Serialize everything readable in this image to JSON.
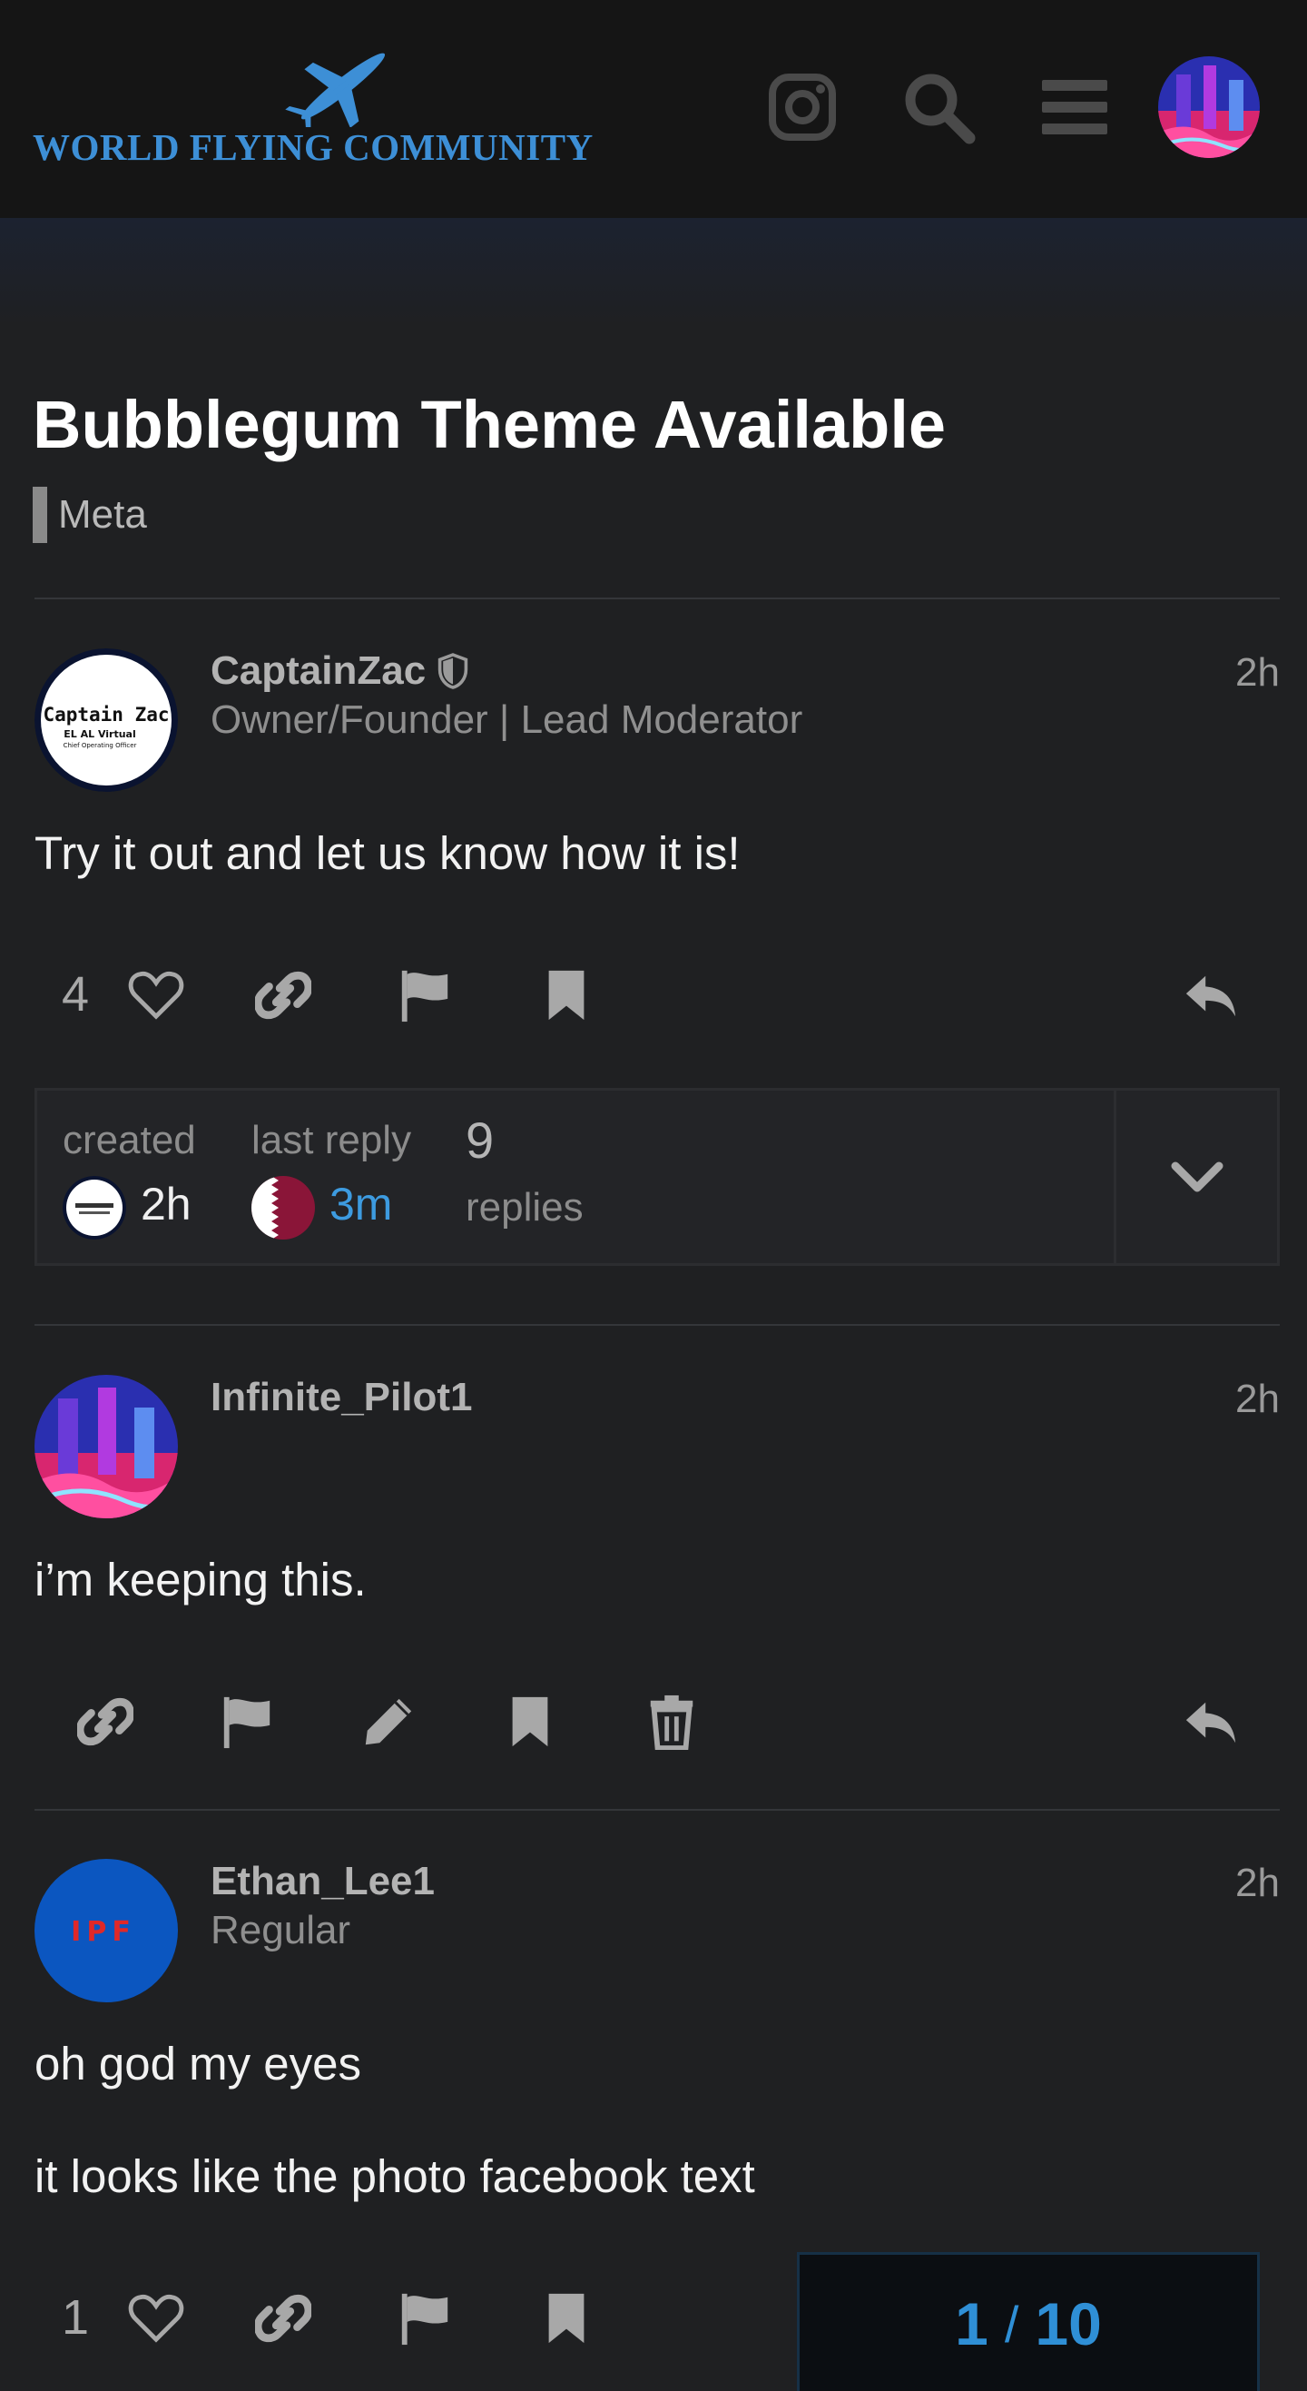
{
  "site": {
    "logo_text": "WORLD FLYING COMMUNITY",
    "brand_color": "#3d8fd6",
    "icons": [
      "plane-icon",
      "instagram-icon",
      "search-icon",
      "hamburger-menu-icon",
      "user-avatar"
    ]
  },
  "topic": {
    "title": "Bubblegum Theme Available",
    "category": "Meta"
  },
  "posts": [
    {
      "username": "CaptainZac",
      "user_title": "Owner/Founder | Lead Moderator",
      "time": "2h",
      "body": [
        "Try it out and let us know how it is!"
      ],
      "likes": "4",
      "avatar_text": [
        "Captain Zac",
        "EL AL Virtual",
        "Chief Operating Officer"
      ]
    },
    {
      "username": "Infinite_Pilot1",
      "user_title": "",
      "time": "2h",
      "body": [
        "i’m keeping this."
      ]
    },
    {
      "username": "Ethan_Lee1",
      "user_title": "Regular",
      "time": "2h",
      "body": [
        "oh god my eyes",
        "it looks like the photo facebook text"
      ],
      "likes": "1",
      "avatar_text": [
        "IPF"
      ]
    }
  ],
  "summary": {
    "created_label": "created",
    "created_time": "2h",
    "last_reply_label": "last reply",
    "last_reply_time": "3m",
    "replies_count": "9",
    "replies_label": "replies"
  },
  "progress": {
    "current": "1",
    "separator": "/",
    "total": "10"
  }
}
